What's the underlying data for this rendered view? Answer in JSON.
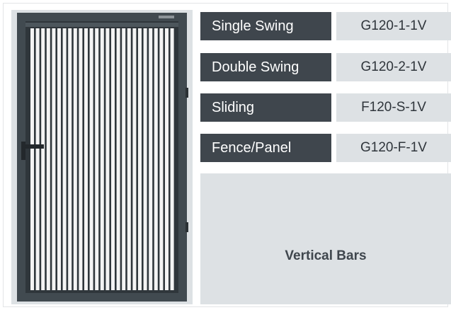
{
  "gate_image": {
    "icon": "vertical-bar-gate-icon",
    "frame_color": "#414a50",
    "bar_color": "#f4f4f4",
    "backdrop_color": "#dde1e4"
  },
  "models": [
    {
      "type": "Single Swing",
      "code": "G120-1-1V"
    },
    {
      "type": "Double Swing",
      "code": "G120-2-1V"
    },
    {
      "type": "Sliding",
      "code": "F120-S-1V"
    },
    {
      "type": "Fence/Panel",
      "code": "G120-F-1V"
    }
  ],
  "feature": {
    "label": "Vertical Bars"
  },
  "colors": {
    "label_bg": "#3f464d",
    "code_bg": "#dde1e4",
    "feature_bg": "#dde1e4"
  }
}
